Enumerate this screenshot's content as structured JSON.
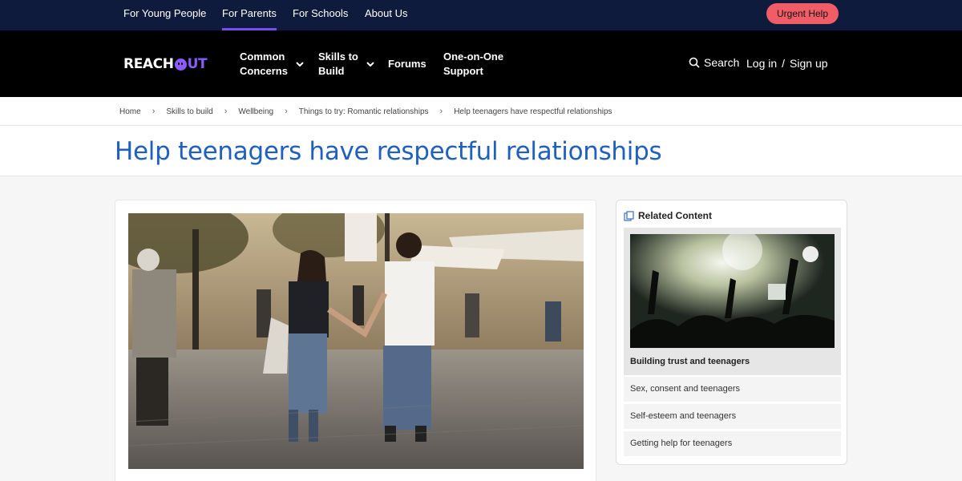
{
  "topbar": {
    "links": [
      "For Young People",
      "For Parents",
      "For Schools",
      "About Us"
    ],
    "active": "For Parents",
    "urgent_label": "Urgent Help"
  },
  "nav": {
    "logo_reach": "REACH",
    "logo_out": "UT",
    "items": [
      {
        "label": "Common\nConcerns"
      },
      {
        "label": "Skills to\nBuild"
      },
      {
        "label": "Forums"
      },
      {
        "label": "One-on-One\nSupport"
      }
    ],
    "search_label": "Search",
    "login_label": "Log in",
    "separator": "/",
    "signup_label": "Sign up"
  },
  "breadcrumb": [
    "Home",
    "Skills to build",
    "Wellbeing",
    "Things to try: Romantic relationships",
    "Help teenagers have respectful relationships"
  ],
  "page": {
    "title": "Help teenagers have respectful relationships"
  },
  "related": {
    "heading": "Related Content",
    "feature_title": "Building trust and teenagers",
    "items": [
      "Sex, consent and teenagers",
      "Self-esteem and teenagers",
      "Getting help for teenagers"
    ]
  },
  "colors": {
    "topbar_bg": "#0f1b3d",
    "nav_bg": "#000000",
    "accent_purple": "#7b4df0",
    "urgent_bg": "#f15d67",
    "title_blue": "#1f5fbf"
  }
}
